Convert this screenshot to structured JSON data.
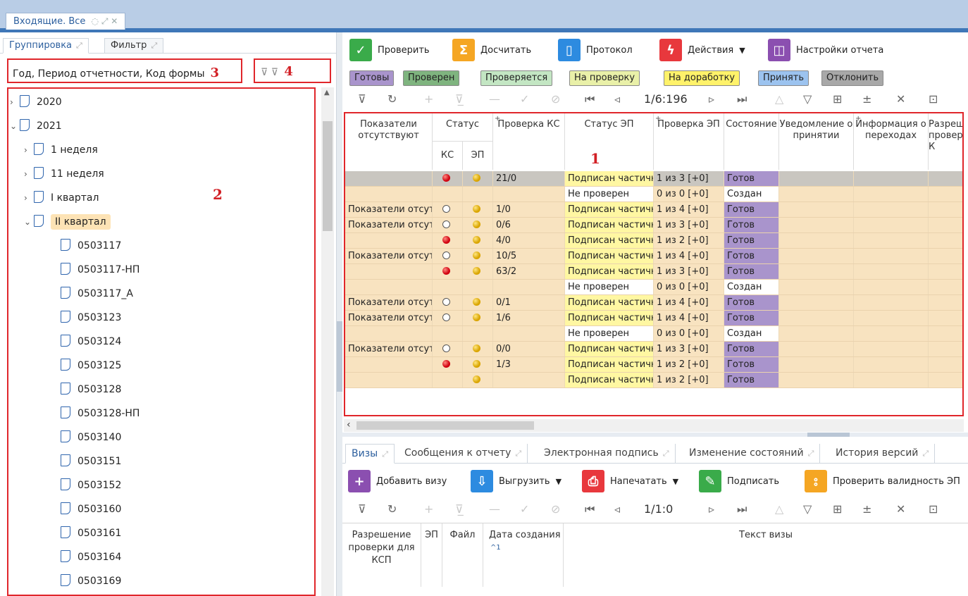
{
  "doc_tab": {
    "title": "Входящие. Все",
    "icons": "◌ ⤢ ✕"
  },
  "left": {
    "tabs": [
      {
        "label": "Группировка"
      },
      {
        "label": "Фильтр"
      }
    ],
    "tab_icon": "⤢",
    "grouping_text": "Год, Период отчетности, Код формы",
    "marker3": "3",
    "marker4": "4",
    "marker2": "2",
    "filter_icons": "⊽  ⊽",
    "tree": [
      {
        "label": "2020",
        "level": 0,
        "toggle": "›",
        "selected": false
      },
      {
        "label": "2021",
        "level": 0,
        "toggle": "⌄",
        "selected": false
      },
      {
        "label": "1 неделя",
        "level": 1,
        "toggle": "›",
        "selected": false
      },
      {
        "label": "11 неделя",
        "level": 1,
        "toggle": "›",
        "selected": false
      },
      {
        "label": "I квартал",
        "level": 1,
        "toggle": "›",
        "selected": false
      },
      {
        "label": "II квартал",
        "level": 1,
        "toggle": "⌄",
        "selected": true
      },
      {
        "label": "0503117",
        "level": 2,
        "toggle": "",
        "selected": false
      },
      {
        "label": "0503117-НП",
        "level": 2,
        "toggle": "",
        "selected": false
      },
      {
        "label": "0503117_А",
        "level": 2,
        "toggle": "",
        "selected": false
      },
      {
        "label": "0503123",
        "level": 2,
        "toggle": "",
        "selected": false
      },
      {
        "label": "0503124",
        "level": 2,
        "toggle": "",
        "selected": false
      },
      {
        "label": "0503125",
        "level": 2,
        "toggle": "",
        "selected": false
      },
      {
        "label": "0503128",
        "level": 2,
        "toggle": "",
        "selected": false
      },
      {
        "label": "0503128-НП",
        "level": 2,
        "toggle": "",
        "selected": false
      },
      {
        "label": "0503140",
        "level": 2,
        "toggle": "",
        "selected": false
      },
      {
        "label": "0503151",
        "level": 2,
        "toggle": "",
        "selected": false
      },
      {
        "label": "0503152",
        "level": 2,
        "toggle": "",
        "selected": false
      },
      {
        "label": "0503160",
        "level": 2,
        "toggle": "",
        "selected": false
      },
      {
        "label": "0503161",
        "level": 2,
        "toggle": "",
        "selected": false
      },
      {
        "label": "0503164",
        "level": 2,
        "toggle": "",
        "selected": false
      },
      {
        "label": "0503169",
        "level": 2,
        "toggle": "",
        "selected": false
      }
    ]
  },
  "toolbar": {
    "buttons": [
      {
        "label": "Проверить",
        "icon": "✓",
        "color": "#3aab4a",
        "dropdown": false
      },
      {
        "label": "Досчитать",
        "icon": "Σ",
        "color": "#f5a623",
        "dropdown": false
      },
      {
        "label": "Протокол",
        "icon": "▯",
        "color": "#2d8be0",
        "dropdown": false
      },
      {
        "label": "Действия",
        "icon": "ϟ",
        "color": "#e8383d",
        "dropdown": true
      },
      {
        "label": "Настройки отчета",
        "icon": "◫",
        "color": "#8b4fb0",
        "dropdown": false
      }
    ],
    "dd_arrow": "▼"
  },
  "status_buttons": [
    {
      "label": "Готовы",
      "color": "#a994cc"
    },
    {
      "label": "Проверен",
      "color": "#7fb47f"
    },
    {
      "label": "Проверяется",
      "color": "#c3e6c3"
    },
    {
      "label": "На проверку",
      "color": "#e9f0a8"
    },
    {
      "label": "На доработку",
      "color": "#fff26a"
    },
    {
      "label": "Принять",
      "color": "#9cc3ef"
    },
    {
      "label": "Отклонить",
      "color": "#a8a8a8"
    }
  ],
  "nav_top": {
    "page": "1/6:196"
  },
  "nav_bottom": {
    "page": "1/1:0"
  },
  "nav_icons": [
    "⊽",
    "↻",
    "+",
    "⊽̲",
    "—",
    "✓",
    "⊘",
    "⏮",
    "◃",
    "▹",
    "⏭",
    "△",
    "▽",
    "⊞",
    "±",
    "✕",
    "⊡"
  ],
  "grid": {
    "marker": "1",
    "headers": {
      "missing": "Показатели отсутствуют",
      "status": "Статус",
      "ks": "КС",
      "ep": "ЭП",
      "check_ks": "Проверка КС",
      "ep_status": "Статус ЭП",
      "check_ep": "Проверка ЭП",
      "state": "Состояние",
      "notice": "Уведомление о принятии",
      "info": "Информация о переходах",
      "perm": "Разрешение проверки К"
    },
    "plus": "+",
    "rows": [
      {
        "missing": "",
        "ks": "red",
        "ep": "gold",
        "check": "21/0",
        "sig": "Подписан частично",
        "sig_ok": true,
        "check_ep": "1 из 3 [+0]",
        "state": "Готов"
      },
      {
        "missing": "",
        "ks": "",
        "ep": "",
        "check": "",
        "sig": "Не проверен",
        "sig_ok": false,
        "check_ep": "0 из 0 [+0]",
        "state": "Создан"
      },
      {
        "missing": "Показатели отсутствуют",
        "ks": "empty",
        "ep": "gold",
        "check": "1/0",
        "sig": "Подписан частично",
        "sig_ok": true,
        "check_ep": "1 из 4 [+0]",
        "state": "Готов"
      },
      {
        "missing": "Показатели отсутствуют",
        "ks": "empty",
        "ep": "gold",
        "check": "0/6",
        "sig": "Подписан частично",
        "sig_ok": true,
        "check_ep": "1 из 3 [+0]",
        "state": "Готов"
      },
      {
        "missing": "",
        "ks": "red",
        "ep": "gold",
        "check": "4/0",
        "sig": "Подписан частично",
        "sig_ok": true,
        "check_ep": "1 из 2 [+0]",
        "state": "Готов"
      },
      {
        "missing": "Показатели отсутствуют",
        "ks": "empty",
        "ep": "gold",
        "check": "10/5",
        "sig": "Подписан частично",
        "sig_ok": true,
        "check_ep": "1 из 4 [+0]",
        "state": "Готов"
      },
      {
        "missing": "",
        "ks": "red",
        "ep": "gold",
        "check": "63/2",
        "sig": "Подписан частично",
        "sig_ok": true,
        "check_ep": "1 из 3 [+0]",
        "state": "Готов"
      },
      {
        "missing": "",
        "ks": "",
        "ep": "",
        "check": "",
        "sig": "Не проверен",
        "sig_ok": false,
        "check_ep": "0 из 0 [+0]",
        "state": "Создан"
      },
      {
        "missing": "Показатели отсутствуют",
        "ks": "empty",
        "ep": "gold",
        "check": "0/1",
        "sig": "Подписан частично",
        "sig_ok": true,
        "check_ep": "1 из 4 [+0]",
        "state": "Готов"
      },
      {
        "missing": "Показатели отсутствуют",
        "ks": "empty",
        "ep": "gold",
        "check": "1/6",
        "sig": "Подписан частично",
        "sig_ok": true,
        "check_ep": "1 из 4 [+0]",
        "state": "Готов"
      },
      {
        "missing": "",
        "ks": "",
        "ep": "",
        "check": "",
        "sig": "Не проверен",
        "sig_ok": false,
        "check_ep": "0 из 0 [+0]",
        "state": "Создан"
      },
      {
        "missing": "Показатели отсутствуют",
        "ks": "empty",
        "ep": "gold",
        "check": "0/0",
        "sig": "Подписан частично",
        "sig_ok": true,
        "check_ep": "1 из 3 [+0]",
        "state": "Готов"
      },
      {
        "missing": "",
        "ks": "red",
        "ep": "gold",
        "check": "1/3",
        "sig": "Подписан частично",
        "sig_ok": true,
        "check_ep": "1 из 2 [+0]",
        "state": "Готов"
      },
      {
        "missing": "",
        "ks": "",
        "ep": "gold",
        "check": "",
        "sig": "Подписан частично",
        "sig_ok": true,
        "check_ep": "1 из 2 [+0]",
        "state": "Готов"
      }
    ]
  },
  "bottom": {
    "tabs": [
      {
        "label": "Визы",
        "active": true
      },
      {
        "label": "Сообщения к отчету",
        "active": false
      },
      {
        "label": "Электронная подпись",
        "active": false
      },
      {
        "label": "Изменение состояний",
        "active": false
      },
      {
        "label": "История версий",
        "active": false
      }
    ],
    "tab_icon": "⤢",
    "toolbar": [
      {
        "label": "Добавить визу",
        "icon": "+",
        "color": "#8b4fb0",
        "dropdown": false
      },
      {
        "label": "Выгрузить",
        "icon": "⇩",
        "color": "#2d8be0",
        "dropdown": true
      },
      {
        "label": "Напечатать",
        "icon": "⎙",
        "color": "#e8383d",
        "dropdown": true
      },
      {
        "label": "Подписать",
        "icon": "✎",
        "color": "#3aab4a",
        "dropdown": false
      },
      {
        "label": "Проверить валидность ЭП",
        "icon": "⦂",
        "color": "#f5a623",
        "dropdown": false
      }
    ],
    "headers": {
      "perm": "Разрешение проверки для КСП",
      "ep": "ЭП",
      "file": "Файл",
      "created": "Дата создания",
      "sort": "^1",
      "text": "Текст визы"
    }
  }
}
